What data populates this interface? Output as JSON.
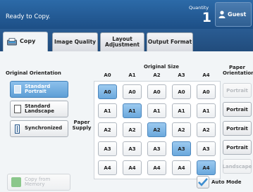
{
  "header": {
    "status": "Ready to Copy.",
    "quantity_label": "Quantity",
    "quantity_value": "1",
    "user_label": "Guest"
  },
  "tabs": [
    {
      "label": "Copy",
      "active": true
    },
    {
      "label": "Image Quality",
      "active": false
    },
    {
      "label": "Layout Adjustment",
      "active": false
    },
    {
      "label": "Output Format",
      "active": false
    }
  ],
  "orientation": {
    "heading": "Original Orientation",
    "options": [
      {
        "label": "Standard Portrait",
        "selected": true
      },
      {
        "label": "Standard Landscape",
        "selected": false
      },
      {
        "label": "Synchronized",
        "selected": false
      }
    ]
  },
  "size_grid": {
    "heading": "Original Size",
    "row_label": "Paper Supply",
    "columns": [
      "A0",
      "A1",
      "A2",
      "A3",
      "A4"
    ],
    "rows": [
      [
        "A0",
        "A0",
        "A0",
        "A0",
        "A0"
      ],
      [
        "A1",
        "A1",
        "A1",
        "A1",
        "A1"
      ],
      [
        "A2",
        "A2",
        "A2",
        "A2",
        "A2"
      ],
      [
        "A3",
        "A3",
        "A3",
        "A3",
        "A3"
      ],
      [
        "A4",
        "A4",
        "A4",
        "A4",
        "A4"
      ]
    ],
    "selected": [
      [
        0,
        0
      ],
      [
        1,
        1
      ],
      [
        2,
        2
      ],
      [
        3,
        3
      ],
      [
        4,
        4
      ]
    ]
  },
  "paper_orientation": {
    "heading": "Paper Orientation",
    "options": [
      {
        "label": "Portrait",
        "enabled": false
      },
      {
        "label": "Portrait",
        "enabled": true
      },
      {
        "label": "Portrait",
        "enabled": true
      },
      {
        "label": "Portrait",
        "enabled": true
      },
      {
        "label": "Landscape",
        "enabled": false
      }
    ]
  },
  "footer": {
    "copy_from_memory": "Copy from Memory",
    "auto_mode": "Auto Mode"
  },
  "colors": {
    "selected": "#6aa8dc",
    "topbar": "#1d4f86"
  }
}
